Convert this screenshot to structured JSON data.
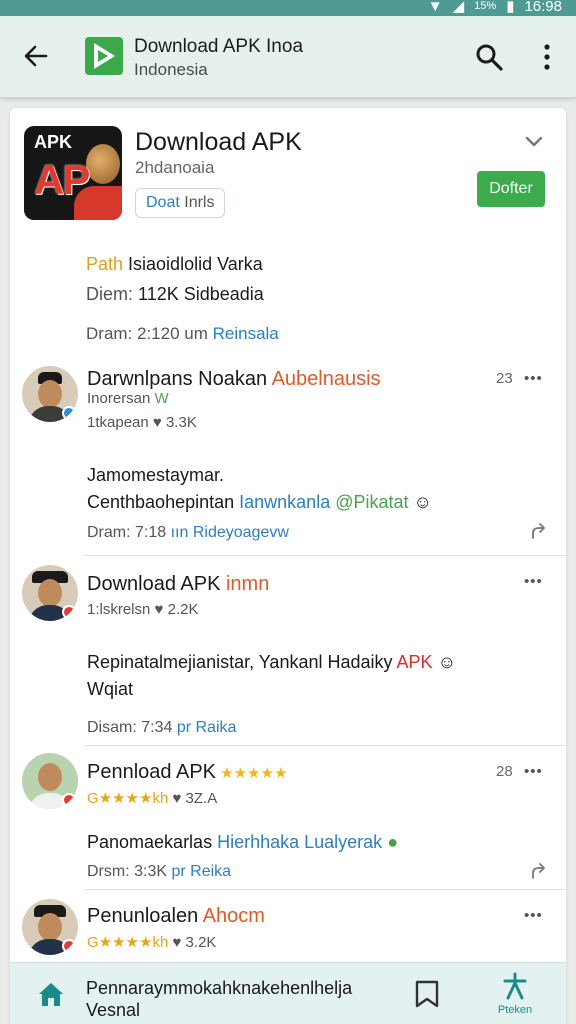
{
  "status_bar": {
    "battery": "15%",
    "time": "16:98"
  },
  "app_bar": {
    "title": "Download APK Inoa",
    "subtitle": "Indonesia"
  },
  "hero": {
    "icon_text_top": "APK",
    "icon_text_main": "AP",
    "title": "Download APK",
    "subtitle": "2hdanoaia",
    "chip_part1": "Doat",
    "chip_part2": " Inrls",
    "button": "Dofter"
  },
  "info": {
    "line1_hl": "Path",
    "line1_rest": " Isiaoidlolid Varka",
    "line2_label": "Diem:",
    "line2_value": " 112K Sidbeadia",
    "line3_label": "Dram:",
    "line3_value": " 2:120",
    "line3_unit": " um",
    "line3_link": " Reinsala"
  },
  "posts": [
    {
      "name_a": "Darwnlpans Noakan",
      "name_b": " Aubelnausis",
      "meta_a": "Inorersan",
      "meta_b": " W",
      "stats": "1tkapean  ♥  3.3K",
      "number": "23",
      "body_1": "Jamomestaymar.",
      "body_2a": "Centhbaohepintan",
      "body_2b": " Ianwnkanla",
      "body_2c": " @Pikatat",
      "foot_label": "Dram:",
      "foot_value": " 7:18",
      "foot_unit": " ıın",
      "foot_link": " Rideyoagevw"
    },
    {
      "name_a": "Download APK",
      "name_b": "  inmn",
      "stats": "1:lskrelsn  ♥  2.2K",
      "body_1a": "Repinatalmejianistar, Yankanl Hadaiky",
      "body_1b": " APK",
      "body_2": "Wqiat",
      "foot_label": "Disam:",
      "foot_value": " 7:34",
      "foot_link": " pr Raika"
    },
    {
      "name_a": "Pennload APK",
      "name_stars": " ★★★★★",
      "meta_stars": "G★★★★kh",
      "meta_stats": "  ♥  3Z.A",
      "number": "28",
      "body_a": "Panomaekarlas",
      "body_b": " Hierhhaka Lualyerak",
      "foot_label": "Drsm:",
      "foot_value": " 3:3K",
      "foot_link": " pr Reika"
    },
    {
      "name_a": "Penunloalen",
      "name_b": " Ahocm",
      "meta_stars": "G★★★★kh",
      "meta_stats": "  ♥  3.2K"
    }
  ],
  "bottom_nav": {
    "text_1": "Pennaraymmokahknakehenlhelja",
    "text_2": "Vesnal",
    "tab_label": "Pteken"
  }
}
